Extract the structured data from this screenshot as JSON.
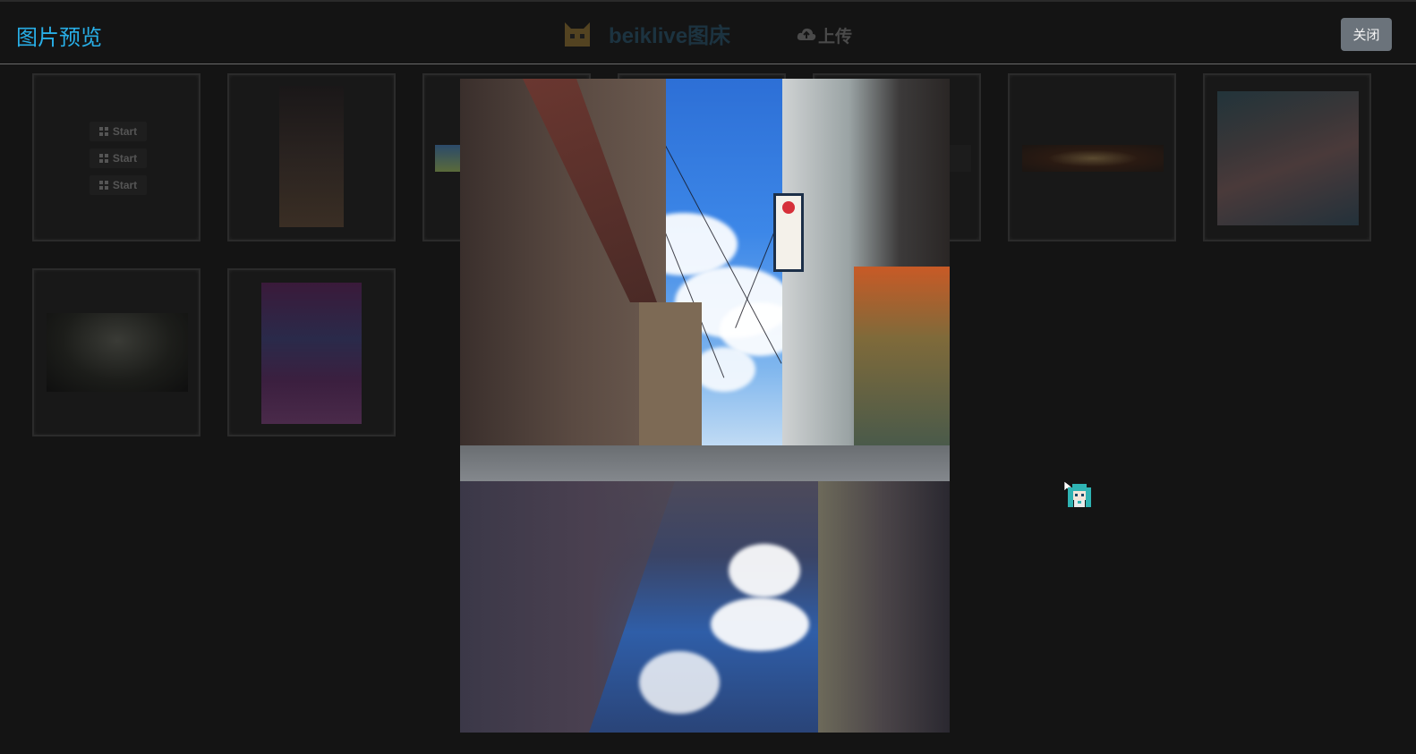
{
  "header": {
    "modal_title": "图片预览",
    "brand_name": "beiklive图床",
    "upload_label": "上传",
    "close_label": "关闭"
  },
  "gallery": {
    "start_buttons": [
      "Start",
      "Start",
      "Start"
    ]
  },
  "colors": {
    "accent": "#28aee6",
    "background": "#141414",
    "close_button": "#6b737b"
  },
  "icons": {
    "upload": "cloud-upload-icon",
    "brand": "cat-logo-icon",
    "windows": "windows-icon",
    "mascot": "miku-mascot-icon",
    "cursor": "mouse-cursor-icon"
  }
}
